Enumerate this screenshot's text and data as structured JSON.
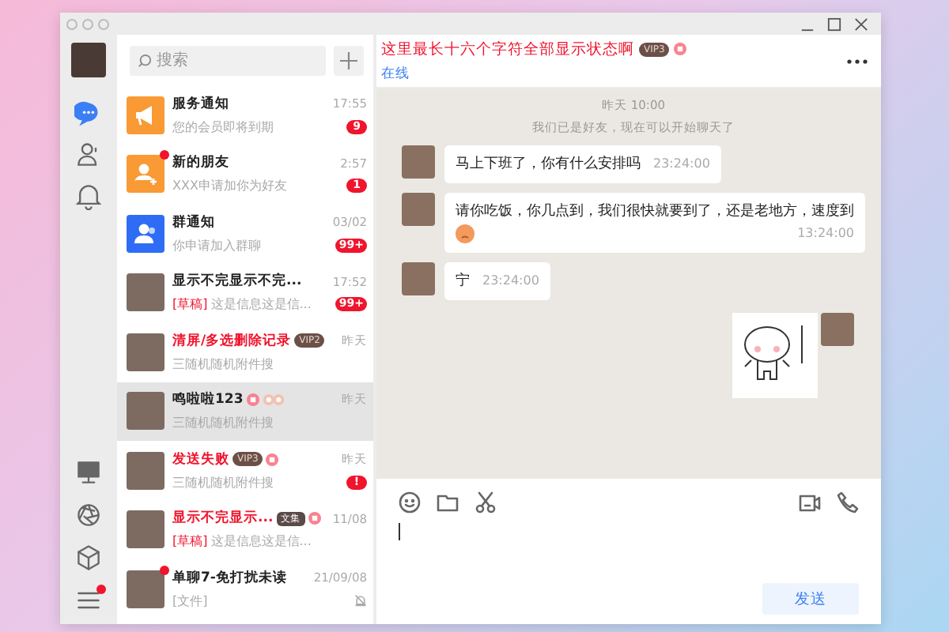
{
  "rail": {
    "nav": [
      {
        "kind": "chat",
        "selected": true
      },
      {
        "kind": "contacts",
        "selected": false
      },
      {
        "kind": "bell",
        "selected": false
      }
    ],
    "bottom": [
      {
        "kind": "monitor"
      },
      {
        "kind": "aperture"
      },
      {
        "kind": "cube"
      },
      {
        "kind": "menu",
        "dot": true
      }
    ]
  },
  "search": {
    "placeholder": "搜索"
  },
  "conversations": [
    {
      "kind": "megaphone",
      "name": "服务通知",
      "highlight": false,
      "time": "17:55",
      "preview": "您的会员即将到期",
      "badge": "9",
      "selected": false
    },
    {
      "kind": "person-add",
      "name": "新的朋友",
      "highlight": false,
      "time": "2:57",
      "preview": "XXX申请加你为好友",
      "badge": "1",
      "dot": true,
      "selected": false
    },
    {
      "kind": "group",
      "name": "群通知",
      "highlight": false,
      "time": "03/02",
      "preview": "你申请加入群聊",
      "badge": "99+",
      "selected": false
    },
    {
      "kind": "photo",
      "name": "显示不完显示不完...",
      "highlight": false,
      "time": "17:52",
      "draft": "[草稿]",
      "preview": "这是信息这是信...",
      "badge": "99+",
      "selected": false
    },
    {
      "kind": "photo",
      "name": "清屏/多选删除记录",
      "highlight": true,
      "tags": [
        {
          "kind": "vip",
          "text": "VIP2"
        }
      ],
      "time": "昨天",
      "preview": "三随机随机附件搜",
      "selected": false
    },
    {
      "kind": "photo",
      "name": "鸣啦啦123",
      "highlight": false,
      "tags": [
        {
          "kind": "medal"
        },
        {
          "kind": "pair"
        }
      ],
      "time": "昨天",
      "preview": "三随机随机附件搜",
      "selected": true
    },
    {
      "kind": "photo",
      "name": "发送失败",
      "highlight": true,
      "tags": [
        {
          "kind": "vip",
          "text": "VIP3"
        },
        {
          "kind": "medal"
        }
      ],
      "time": "昨天",
      "preview": "三随机随机附件搜",
      "badge": "!",
      "selected": false
    },
    {
      "kind": "photo",
      "name": "显示不完显示...",
      "highlight": true,
      "tags": [
        {
          "kind": "label",
          "text": "文集"
        },
        {
          "kind": "medal"
        }
      ],
      "time": "11/08",
      "draft": "[草稿]",
      "preview": "这是信息这是信...",
      "selected": false
    },
    {
      "kind": "photo",
      "name": "单聊7-免打扰未读",
      "highlight": false,
      "time": "21/09/08",
      "preview": "[文件]",
      "dot": true,
      "muted": true,
      "selected": false
    }
  ],
  "chat": {
    "title": "这里最长十六个字符全部显示状态啊",
    "tags": [
      {
        "kind": "vip",
        "text": "VIP3"
      },
      {
        "kind": "medal"
      }
    ],
    "status": "在线",
    "messages": [
      {
        "kind": "time",
        "text": "昨天 10:00"
      },
      {
        "kind": "system",
        "text": "我们已是好友，现在可以开始聊天了"
      },
      {
        "kind": "text",
        "text": "马上下班了，你有什么安排吗",
        "time": "23:24:00"
      },
      {
        "kind": "text",
        "text": "请你吃饭，你几点到，我们很快就要到了，还是老地方，速度到",
        "time": "13:24:00",
        "emoji": true
      },
      {
        "kind": "text",
        "text": "宁",
        "time": "23:24:00"
      },
      {
        "kind": "sticker"
      }
    ],
    "send": "发送"
  }
}
